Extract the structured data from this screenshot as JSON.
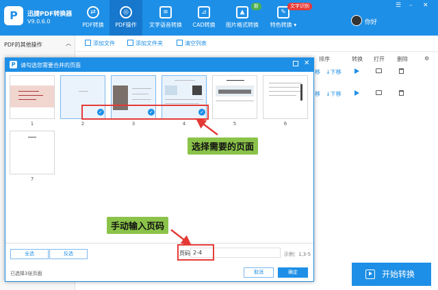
{
  "app": {
    "name": "迅捷PDF转换器",
    "version": "V9.0.6.0",
    "logo_letter": "P"
  },
  "nav": [
    {
      "label": "PDF转换",
      "icon": "pdf-convert-icon"
    },
    {
      "label": "PDF操作",
      "icon": "pdf-operate-icon",
      "active": true
    },
    {
      "label": "文字语音转换",
      "icon": "voice-icon"
    },
    {
      "label": "CAD转换",
      "icon": "cad-icon"
    },
    {
      "label": "图片格式转换",
      "icon": "image-icon",
      "badge": "新"
    },
    {
      "label": "特色转换",
      "icon": "special-icon",
      "badge": "文字识别"
    }
  ],
  "user": {
    "name": "你好"
  },
  "sidebar": {
    "title": "PDF的其他操作"
  },
  "toolbar": {
    "add_file": "添加文件",
    "add_folder": "添加文件夹",
    "clear_list": "清空列表"
  },
  "table": {
    "headers": [
      "排序",
      "转换",
      "打开",
      "删除"
    ],
    "rows": [
      {
        "sort": "下移",
        "sort_prefix": "移"
      },
      {
        "sort": "下移",
        "sort_prefix": "移"
      }
    ]
  },
  "start_button": "开始转换",
  "dialog": {
    "title": "请勾选您需要合并的页面",
    "pages": [
      {
        "num": "1",
        "selected": false
      },
      {
        "num": "2",
        "selected": true
      },
      {
        "num": "3",
        "selected": true
      },
      {
        "num": "4",
        "selected": true
      },
      {
        "num": "5",
        "selected": false
      },
      {
        "num": "6",
        "selected": false
      },
      {
        "num": "7",
        "selected": false
      }
    ],
    "select_all": "全选",
    "invert": "反选",
    "page_label": "页码",
    "page_value": "2-4",
    "example": "示例：1,3-5",
    "selected_count": "已选择3张页面",
    "cancel": "取消",
    "ok": "确定"
  },
  "annotations": {
    "select_pages": "选择需要的页面",
    "manual_input": "手动输入页码"
  },
  "colors": {
    "brand": "#1e8fe6",
    "highlight": "#e53935",
    "callout": "#8bc34a"
  }
}
